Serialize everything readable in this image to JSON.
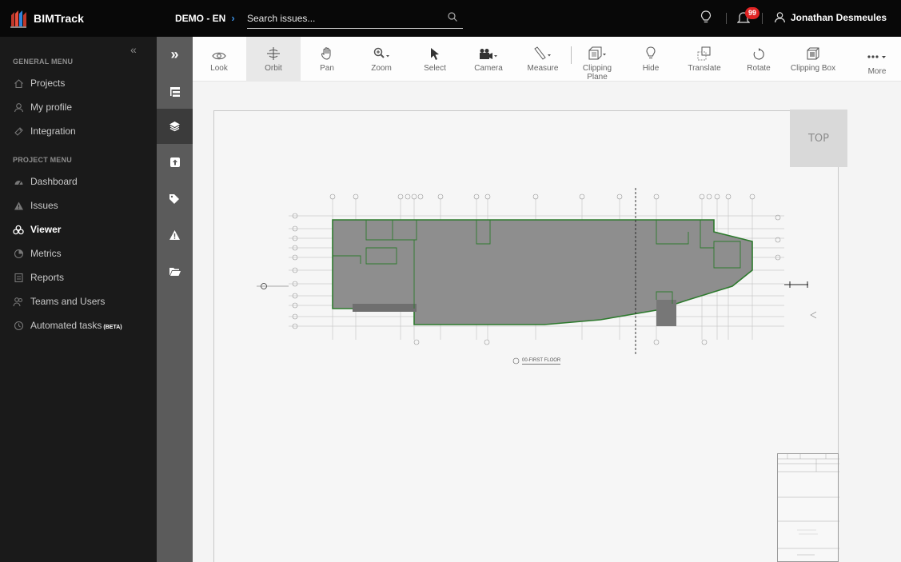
{
  "app": {
    "name": "BIMTrack"
  },
  "header": {
    "project": "DEMO - EN",
    "search_placeholder": "Search issues...",
    "notification_count": "99",
    "user_name": "Jonathan Desmeules"
  },
  "sidebar": {
    "general_title": "GENERAL MENU",
    "general_items": [
      {
        "label": "Projects",
        "icon": "home-icon"
      },
      {
        "label": "My profile",
        "icon": "user-icon"
      },
      {
        "label": "Integration",
        "icon": "plug-icon"
      }
    ],
    "project_title": "PROJECT MENU",
    "project_items": [
      {
        "label": "Dashboard",
        "icon": "dashboard-icon"
      },
      {
        "label": "Issues",
        "icon": "warning-icon"
      },
      {
        "label": "Viewer",
        "icon": "viewer-icon",
        "active": true
      },
      {
        "label": "Metrics",
        "icon": "metrics-icon"
      },
      {
        "label": "Reports",
        "icon": "reports-icon"
      },
      {
        "label": "Teams and Users",
        "icon": "team-icon"
      },
      {
        "label": "Automated tasks",
        "icon": "clock-icon",
        "suffix": "(BETA)"
      }
    ]
  },
  "rail": [
    "expand-icon",
    "tree-icon",
    "layers-icon",
    "upload-icon",
    "tags-icon",
    "warning-icon",
    "folder-icon"
  ],
  "toolbar": {
    "tools": [
      {
        "label": "Look",
        "icon": "eye-icon"
      },
      {
        "label": "Orbit",
        "icon": "orbit-icon",
        "selected": true
      },
      {
        "label": "Pan",
        "icon": "hand-icon"
      },
      {
        "label": "Zoom",
        "icon": "zoom-icon"
      },
      {
        "label": "Select",
        "icon": "cursor-icon"
      },
      {
        "label": "Camera",
        "icon": "camera-icon"
      },
      {
        "label": "Measure",
        "icon": "ruler-icon"
      },
      {
        "label": "Clipping Plane",
        "icon": "clipping-plane-icon"
      },
      {
        "label": "Hide",
        "icon": "bulb-icon"
      },
      {
        "label": "Translate",
        "icon": "translate-icon"
      },
      {
        "label": "Rotate",
        "icon": "rotate-icon"
      },
      {
        "label": "Clipping Box",
        "icon": "clipping-box-icon"
      },
      {
        "label": "More",
        "icon": "more-icon"
      }
    ]
  },
  "viewer": {
    "view_cube": "TOP",
    "floor_label": "00-FIRST FLOOR"
  }
}
